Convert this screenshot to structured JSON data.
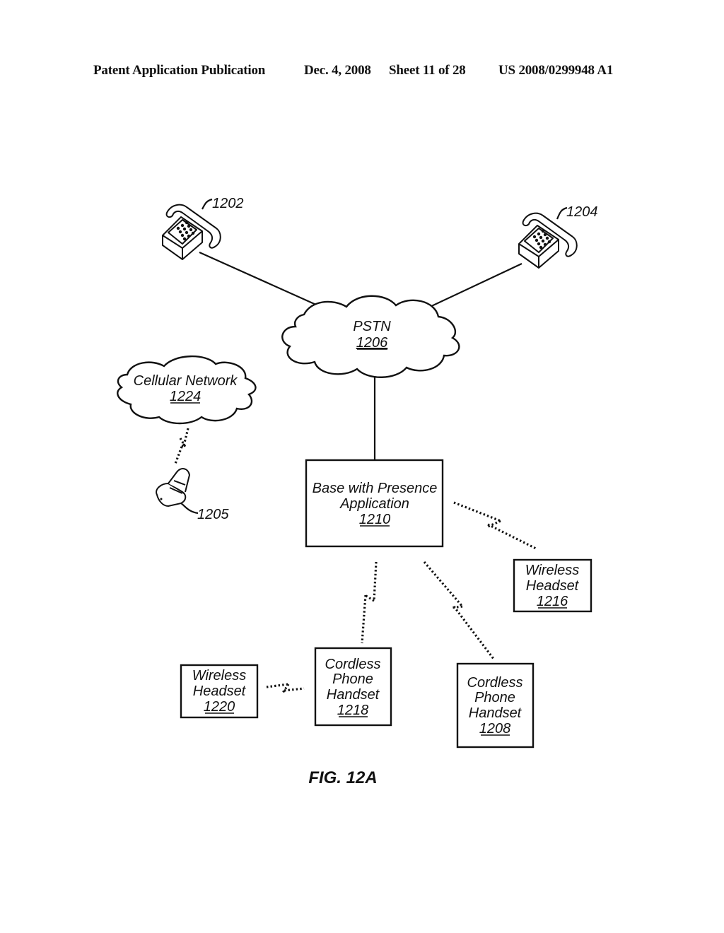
{
  "header": {
    "publication": "Patent Application Publication",
    "date": "Dec. 4, 2008",
    "sheet": "Sheet 11 of 28",
    "patent_number": "US 2008/0299948 A1"
  },
  "figure": {
    "caption": "FIG. 12A",
    "nodes": {
      "phone_1202": {
        "ref": "1202",
        "kind": "desk-telephone"
      },
      "phone_1204": {
        "ref": "1204",
        "kind": "desk-telephone"
      },
      "pstn": {
        "label": "PSTN",
        "ref": "1206"
      },
      "cellular": {
        "label": "Cellular Network",
        "ref": "1224"
      },
      "mobile_1205": {
        "ref": "1205",
        "kind": "mobile-phone"
      },
      "base": {
        "line1": "Base with Presence",
        "line2": "Application",
        "ref": "1210"
      },
      "headset_1216": {
        "line1": "Wireless",
        "line2": "Headset",
        "ref": "1216"
      },
      "headset_1220": {
        "line1": "Wireless",
        "line2": "Headset",
        "ref": "1220"
      },
      "handset_1218": {
        "line1": "Cordless",
        "line2": "Phone",
        "line3": "Handset",
        "ref": "1218"
      },
      "handset_1208": {
        "line1": "Cordless",
        "line2": "Phone",
        "line3": "Handset",
        "ref": "1208"
      }
    },
    "connections": [
      {
        "from": "1202",
        "to": "1206",
        "type": "wired"
      },
      {
        "from": "1204",
        "to": "1206",
        "type": "wired"
      },
      {
        "from": "1206",
        "to": "1210",
        "type": "wired"
      },
      {
        "from": "1224",
        "to": "1205",
        "type": "wireless"
      },
      {
        "from": "1210",
        "to": "1216",
        "type": "wireless"
      },
      {
        "from": "1210",
        "to": "1218",
        "type": "wireless"
      },
      {
        "from": "1210",
        "to": "1208",
        "type": "wireless"
      },
      {
        "from": "1220",
        "to": "1218",
        "type": "wireless"
      }
    ]
  }
}
